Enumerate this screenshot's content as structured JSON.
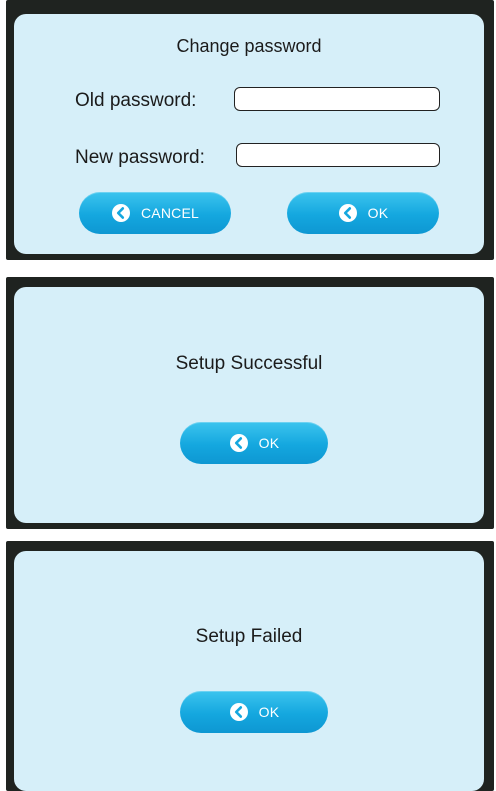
{
  "change_password_dialog": {
    "title": "Change password",
    "old_password_label": "Old password:",
    "new_password_label": "New password:",
    "old_password_value": "",
    "new_password_value": "",
    "cancel_label": "CANCEL",
    "ok_label": "OK"
  },
  "success_dialog": {
    "message": "Setup Successful",
    "ok_label": "OK"
  },
  "failed_dialog": {
    "message": "Setup Failed",
    "ok_label": "OK"
  },
  "colors": {
    "panel_background": "#d6eff9",
    "frame_dark": "#1f2320",
    "button_blue": "#14a7df",
    "button_text": "#ffffff"
  },
  "icons": {
    "button_icon": "chevron-left-circle-icon"
  }
}
